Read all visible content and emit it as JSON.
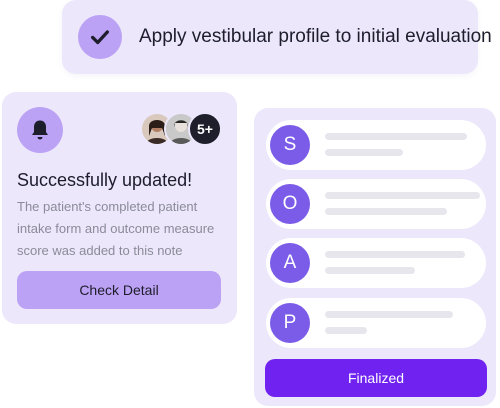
{
  "banner": {
    "text": "Apply vestibular profile to initial evaluation",
    "icon": "check-icon"
  },
  "notification": {
    "icon": "bell-icon",
    "title": "Successfully updated!",
    "description": "The patient's completed patient intake form and outcome measure score was added to this note",
    "more_count": "5+",
    "button_label": "Check Detail"
  },
  "soap": {
    "items": [
      {
        "letter": "S"
      },
      {
        "letter": "O"
      },
      {
        "letter": "A"
      },
      {
        "letter": "P"
      }
    ],
    "button_label": "Finalized"
  },
  "colors": {
    "card_bg": "#ece7fb",
    "accent_light": "#bba2f4",
    "accent": "#7b5ce8",
    "primary_button": "#6f22f0",
    "text_dark": "#1d1d2c",
    "text_muted": "#8b8b99"
  }
}
